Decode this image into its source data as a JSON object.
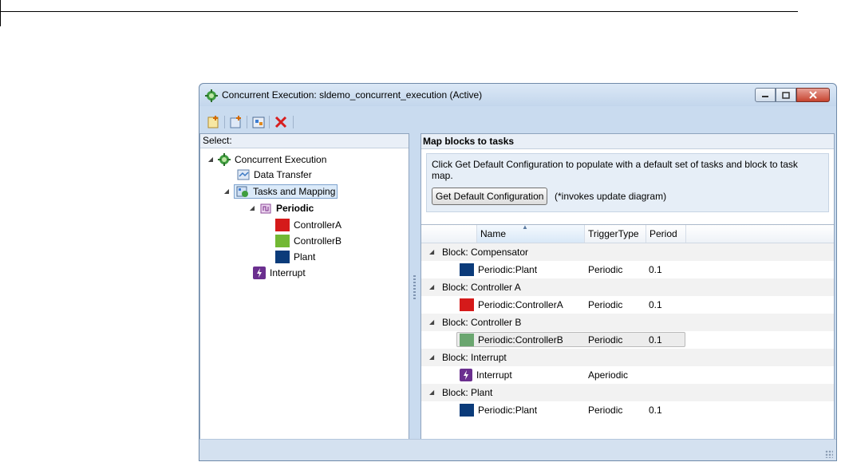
{
  "window": {
    "title": "Concurrent Execution: sldemo_concurrent_execution (Active)"
  },
  "toolbar": {
    "icons": [
      "add-task-icon",
      "add-periodic-icon",
      "add-block-icon",
      "delete-icon"
    ]
  },
  "left_panel": {
    "header": "Select:",
    "tree": [
      {
        "label": "Concurrent Execution",
        "icon": "concurrent-execution-icon",
        "expanded": true
      },
      {
        "label": "Data Transfer",
        "icon": "data-transfer-icon"
      },
      {
        "label": "Tasks and Mapping",
        "icon": "tasks-mapping-icon",
        "expanded": true,
        "selected": true
      },
      {
        "label": "Periodic",
        "icon": "periodic-icon",
        "expanded": true
      },
      {
        "label": "ControllerA",
        "color": "#d51a1a"
      },
      {
        "label": "ControllerB",
        "color": "#72b833"
      },
      {
        "label": "Plant",
        "color": "#0b3b7a"
      },
      {
        "label": "Interrupt",
        "icon": "interrupt-icon"
      }
    ]
  },
  "right_panel": {
    "title": "Map blocks to tasks",
    "info_text": "Click Get Default Configuration to populate with a default set of tasks and block to task map.",
    "default_button": "Get Default Configuration",
    "note": "(*invokes update diagram)",
    "table": {
      "columns": [
        "Name",
        "TriggerType",
        "Period"
      ],
      "groups": [
        {
          "label": "Block: Compensator",
          "rows": [
            {
              "name": "Periodic:Plant",
              "color": "#0b3b7a",
              "trigger": "Periodic",
              "period": "0.1"
            }
          ]
        },
        {
          "label": "Block: Controller A",
          "rows": [
            {
              "name": "Periodic:ControllerA",
              "color": "#d51a1a",
              "trigger": "Periodic",
              "period": "0.1"
            }
          ]
        },
        {
          "label": "Block: Controller B",
          "rows": [
            {
              "name": "Periodic:ControllerB",
              "color": "#6aa66f",
              "trigger": "Periodic",
              "period": "0.1",
              "selected": true
            }
          ]
        },
        {
          "label": "Block: Interrupt",
          "rows": [
            {
              "name": "Interrupt",
              "icon": "interrupt-icon",
              "trigger": "Aperiodic",
              "period": ""
            }
          ]
        },
        {
          "label": "Block: Plant",
          "rows": [
            {
              "name": "Periodic:Plant",
              "color": "#0b3b7a",
              "trigger": "Periodic",
              "period": "0.1"
            }
          ]
        }
      ]
    }
  },
  "colors": {
    "controller_a": "#d51a1a",
    "controller_b": "#72b833",
    "plant": "#0b3b7a",
    "interrupt": "#6b2f8f"
  }
}
